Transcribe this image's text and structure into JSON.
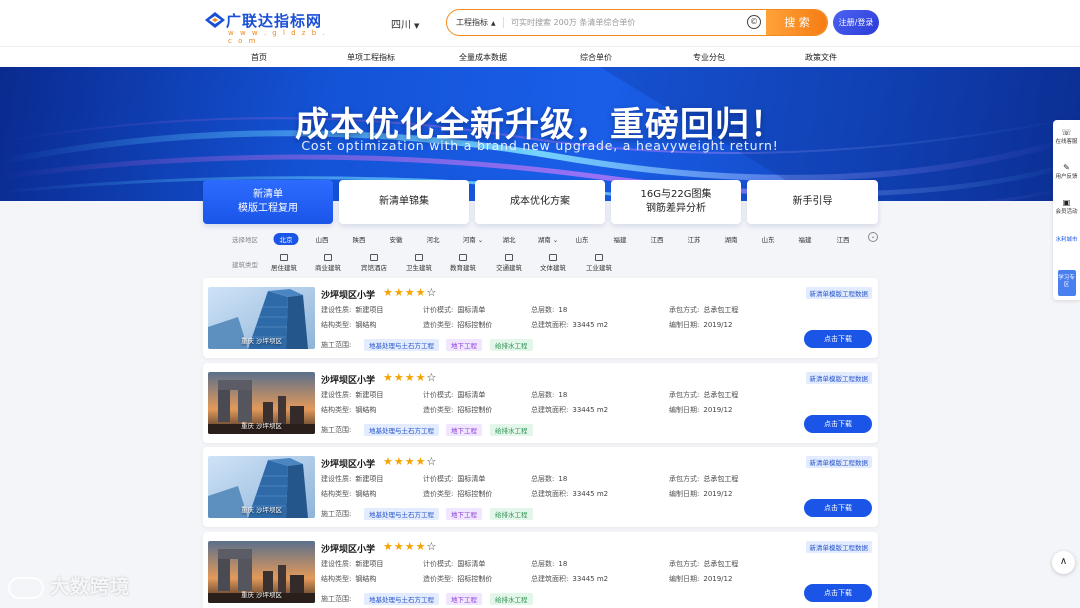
{
  "colors": {
    "brand": "#1a55e8",
    "accent": "#f57c12",
    "star": "#f5a300"
  },
  "header": {
    "logo_name": "广联达指标网",
    "logo_url": "w w w . g l d z b . c o m",
    "region": "四川",
    "search": {
      "type": "工程指标",
      "placeholder": "可实时搜索 200万 条清单综合单价",
      "button": "搜 索"
    },
    "login": "注册/登录"
  },
  "nav": {
    "items": [
      "首页",
      "单项工程指标",
      "全量成本数据",
      "综合单价",
      "专业分包",
      "政策文件"
    ]
  },
  "banner": {
    "title": "成本优化全新升级，重磅回归！",
    "subtitle": "Cost optimization with a brand new upgrade, a heavyweight return!"
  },
  "tabs": [
    {
      "line1": "新清单",
      "line2": "模版工程复用"
    },
    {
      "line1": "新清单锦集",
      "line2": ""
    },
    {
      "line1": "成本优化方案",
      "line2": ""
    },
    {
      "line1": "16G与22G图集",
      "line2": "钢筋差异分析"
    },
    {
      "line1": "新手引导",
      "line2": ""
    }
  ],
  "filters": {
    "region_label": "选择地区",
    "regions": [
      "北京",
      "山西",
      "陕西",
      "安徽",
      "河北",
      "河南",
      "湖北",
      "湖南",
      "山东",
      "福建",
      "江西",
      "江苏",
      "湖南",
      "山东",
      "福建",
      "江西"
    ],
    "type_label": "建筑类型",
    "types": [
      "居住建筑",
      "商业建筑",
      "宾馆酒店",
      "卫生建筑",
      "教育建筑",
      "交通建筑",
      "文体建筑",
      "工业建筑"
    ]
  },
  "card_labels": {
    "build_nature": "建设性质:",
    "pricing_mode": "计价模式:",
    "floors": "总层数:",
    "contract_mode": "承包方式:",
    "structure": "结构类型:",
    "cost_type": "造价类型:",
    "area": "总建筑面积:",
    "compile_date": "编制日期:",
    "scope": "施工范围:",
    "download": "点击下载",
    "badge": "新清单模版工程数据"
  },
  "cards": [
    {
      "title": "沙坪坝区小学",
      "thumb_caption": "重庆 沙坪坝区",
      "rating": 4,
      "build_nature": "新建项目",
      "pricing_mode": "国标清单",
      "floors": "18",
      "contract_mode": "总承包工程",
      "structure": "钢结构",
      "cost_type": "招标控制价",
      "area": "33445 m2",
      "compile_date": "2019/12",
      "tags": [
        "地基处理与土石方工程",
        "地下工程",
        "给排水工程"
      ]
    },
    {
      "title": "沙坪坝区小学",
      "thumb_caption": "重庆 沙坪坝区",
      "rating": 4,
      "build_nature": "新建项目",
      "pricing_mode": "国标清单",
      "floors": "18",
      "contract_mode": "总承包工程",
      "structure": "钢结构",
      "cost_type": "招标控制价",
      "area": "33445 m2",
      "compile_date": "2019/12",
      "tags": [
        "地基处理与土石方工程",
        "地下工程",
        "给排水工程"
      ]
    },
    {
      "title": "沙坪坝区小学",
      "thumb_caption": "重庆 沙坪坝区",
      "rating": 4,
      "build_nature": "新建项目",
      "pricing_mode": "国标清单",
      "floors": "18",
      "contract_mode": "总承包工程",
      "structure": "钢结构",
      "cost_type": "招标控制价",
      "area": "33445 m2",
      "compile_date": "2019/12",
      "tags": [
        "地基处理与土石方工程",
        "地下工程",
        "给排水工程"
      ]
    },
    {
      "title": "沙坪坝区小学",
      "thumb_caption": "重庆 沙坪坝区",
      "rating": 4,
      "build_nature": "新建项目",
      "pricing_mode": "国标清单",
      "floors": "18",
      "contract_mode": "总承包工程",
      "structure": "钢结构",
      "cost_type": "招标控制价",
      "area": "33445 m2",
      "compile_date": "2019/12",
      "tags": [
        "地基处理与土石方工程",
        "地下工程",
        "给排水工程"
      ]
    }
  ],
  "rail": {
    "items": [
      "在线客服",
      "用户反馈",
      "会员活动",
      "水利城市",
      "学习专区"
    ]
  },
  "watermark": "大数跨境"
}
